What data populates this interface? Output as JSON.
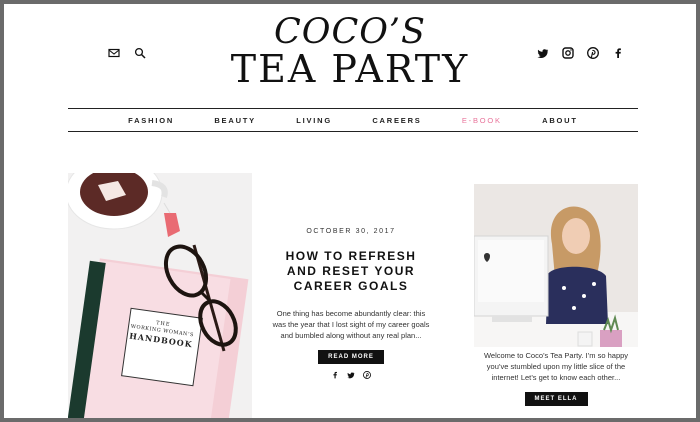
{
  "header": {
    "logo_line1": "COCO’S",
    "logo_line2": "TEA PARTY",
    "left_icons": [
      "mail-icon",
      "search-icon"
    ],
    "right_icons": [
      "twitter-icon",
      "instagram-icon",
      "pinterest-icon",
      "facebook-icon"
    ]
  },
  "nav": {
    "items": [
      "FASHION",
      "BEAUTY",
      "LIVING",
      "CAREERS",
      "E-BOOK",
      "ABOUT"
    ],
    "accent_color": "#e8739a"
  },
  "featured": {
    "book_title_small": "THE",
    "book_title_line1": "WORKING WOMAN’S",
    "book_title_line2": "HANDBOOK"
  },
  "post": {
    "date": "OCTOBER 30, 2017",
    "title_line1": "HOW TO REFRESH",
    "title_line2": "AND RESET YOUR",
    "title_line3": "CAREER GOALS",
    "excerpt": "One thing has become abundantly clear: this was the year that I lost sight of my career goals and bumbled along without any real plan...",
    "read_more": "READ MORE",
    "share_icons": [
      "facebook-icon",
      "twitter-icon",
      "pinterest-icon"
    ]
  },
  "about": {
    "text": "Welcome to Coco’s Tea Party. I’m so happy you’ve stumbled upon my little slice of the internet! Let’s get to know each other...",
    "button": "MEET ELLA"
  }
}
